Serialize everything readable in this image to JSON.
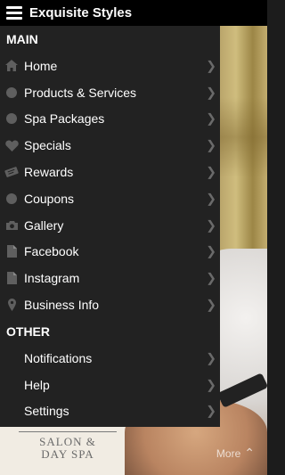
{
  "app": {
    "title": "Exquisite Styles"
  },
  "drawer": {
    "main_header": "MAIN",
    "main_items": [
      {
        "label": "Home",
        "icon": "home-icon"
      },
      {
        "label": "Products & Services",
        "icon": "circle-icon"
      },
      {
        "label": "Spa Packages",
        "icon": "circle-icon"
      },
      {
        "label": "Specials",
        "icon": "heart-icon"
      },
      {
        "label": "Rewards",
        "icon": "ticket-icon"
      },
      {
        "label": "Coupons",
        "icon": "circle-icon"
      },
      {
        "label": "Gallery",
        "icon": "camera-icon"
      },
      {
        "label": "Facebook",
        "icon": "document-icon"
      },
      {
        "label": "Instagram",
        "icon": "document-icon"
      },
      {
        "label": "Business Info",
        "icon": "location-pin-icon"
      }
    ],
    "other_header": "OTHER",
    "other_items": [
      {
        "label": "Notifications"
      },
      {
        "label": "Help"
      },
      {
        "label": "Settings"
      }
    ]
  },
  "background": {
    "logo_line1": "SALON &",
    "logo_line2": "DAY SPA",
    "more_label": "More"
  },
  "colors": {
    "drawer_bg": "#222222",
    "topbar_bg": "#000000",
    "icon_gray": "#5f5f5f"
  }
}
